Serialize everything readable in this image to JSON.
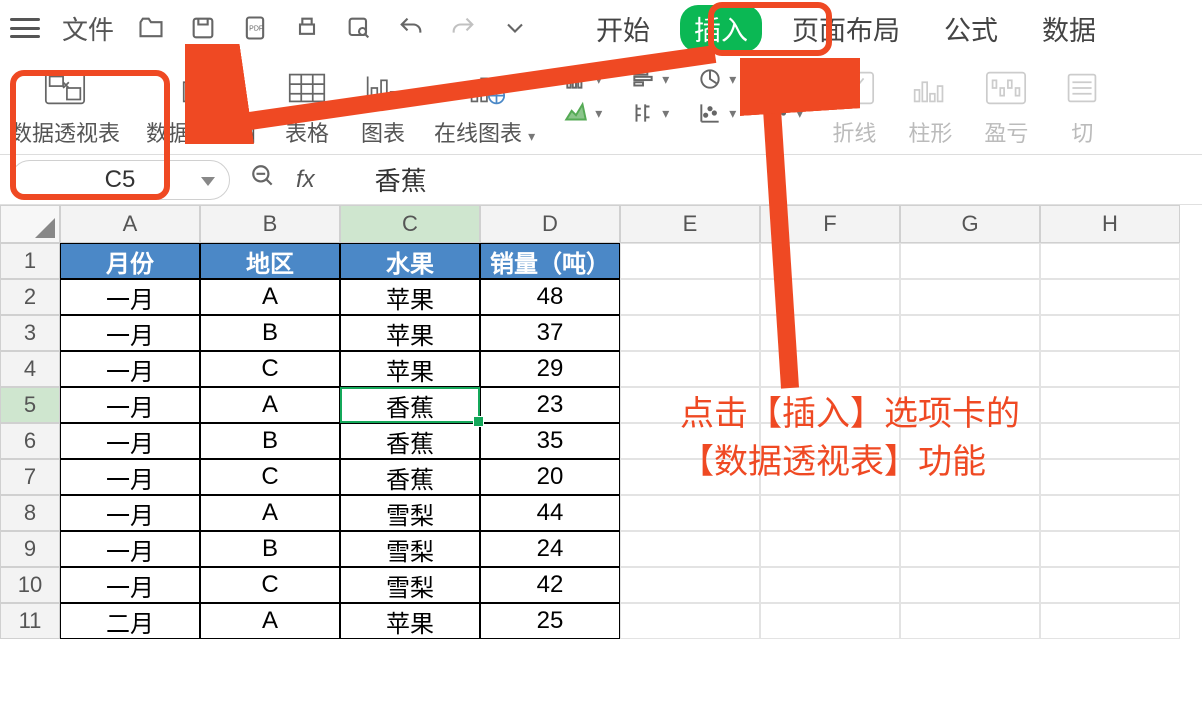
{
  "topbar": {
    "file": "文件",
    "tabs": [
      "开始",
      "插入",
      "页面布局",
      "公式",
      "数据"
    ],
    "active_tab_index": 1
  },
  "ribbon": {
    "pivot_table": "数据透视表",
    "pivot_chart": "数据透视图",
    "table": "表格",
    "chart": "图表",
    "online_chart": "在线图表",
    "sparkline_line": "折线",
    "sparkline_col": "柱形",
    "sparkline_winloss": "盈亏",
    "slicer": "切"
  },
  "fbar": {
    "cell_ref": "C5",
    "fx_label": "fx",
    "formula_value": "香蕉"
  },
  "sheet": {
    "cols": [
      "A",
      "B",
      "C",
      "D",
      "E",
      "F",
      "G",
      "H"
    ],
    "headers": [
      "月份",
      "地区",
      "水果",
      "销量（吨）"
    ],
    "rows": [
      [
        "一月",
        "A",
        "苹果",
        "48"
      ],
      [
        "一月",
        "B",
        "苹果",
        "37"
      ],
      [
        "一月",
        "C",
        "苹果",
        "29"
      ],
      [
        "一月",
        "A",
        "香蕉",
        "23"
      ],
      [
        "一月",
        "B",
        "香蕉",
        "35"
      ],
      [
        "一月",
        "C",
        "香蕉",
        "20"
      ],
      [
        "一月",
        "A",
        "雪梨",
        "44"
      ],
      [
        "一月",
        "B",
        "雪梨",
        "24"
      ],
      [
        "一月",
        "C",
        "雪梨",
        "42"
      ],
      [
        "二月",
        "A",
        "苹果",
        "25"
      ]
    ],
    "selected": {
      "row": 5,
      "col": "C"
    }
  },
  "annotation": {
    "line1": "点击【插入】选项卡的",
    "line2": "【数据透视表】功能"
  }
}
